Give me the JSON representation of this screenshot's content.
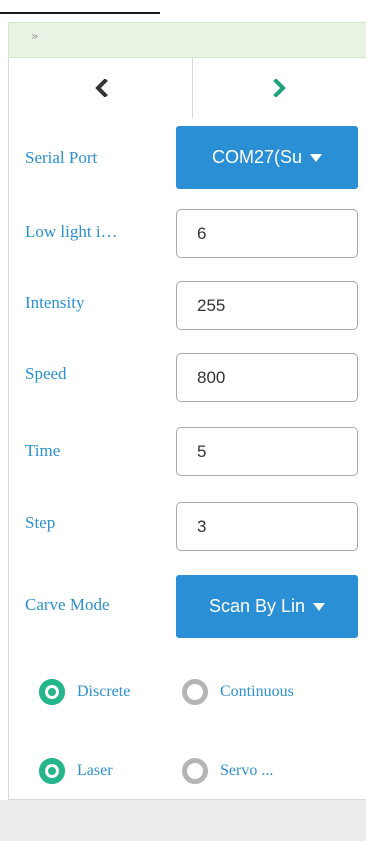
{
  "header": {
    "toggle_label": "»"
  },
  "tabs": {
    "prev_icon": "chevron-left-icon",
    "next_icon": "chevron-right-icon"
  },
  "serial_port": {
    "label": "Serial Port",
    "value": "COM27(Su"
  },
  "low_light": {
    "label": "Low light i…",
    "value": "6"
  },
  "intensity": {
    "label": "Intensity",
    "value": "255"
  },
  "speed": {
    "label": "Speed",
    "value": "800"
  },
  "time": {
    "label": "Time",
    "value": "5"
  },
  "step": {
    "label": "Step",
    "value": "3"
  },
  "carve_mode": {
    "label": "Carve Mode",
    "value": "Scan By Lin"
  },
  "mode_radios": {
    "discrete": "Discrete",
    "continuous": "Continuous",
    "selected": "Discrete"
  },
  "tool_radios": {
    "laser": "Laser",
    "servo": "Servo ...",
    "selected": "Laser"
  },
  "colors": {
    "accent_blue": "#2b8fd6",
    "label_blue": "#2c8fcf",
    "radio_green": "#27b58e",
    "radio_off": "#b5b5b5",
    "header_green": "#e9f3e3"
  }
}
